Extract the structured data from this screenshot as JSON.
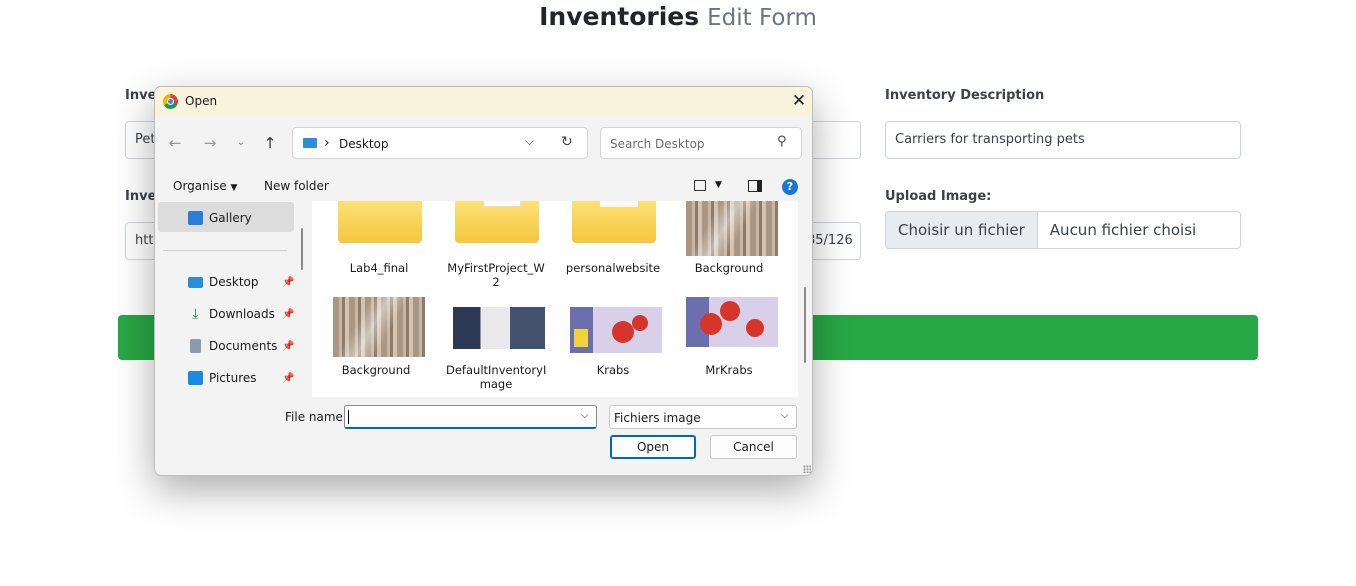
{
  "page": {
    "title": "Inventories",
    "subtitle": "Edit Form",
    "desc_label": "Inventory Description",
    "desc_value": "Carriers for transporting pets",
    "name_label_partial": "Inve",
    "name_value_partial": "Pet",
    "image_label_partial": "Inve",
    "image_value_partial_left": "http",
    "image_value_partial_right": "85/126",
    "upload_label": "Upload Image:",
    "file_button": "Choisir un fichier",
    "file_name": "Aucun fichier choisi",
    "colors": {
      "submit_bar": "#28a745"
    }
  },
  "dialog": {
    "title": "Open",
    "breadcrumb_sep": "›",
    "location": "Desktop",
    "search_placeholder": "Search Desktop",
    "toolbar": {
      "organise": "Organise",
      "new_folder": "New folder",
      "help": "?"
    },
    "nav": [
      {
        "label": "Gallery",
        "icon": "gallery-icon",
        "selected": true
      },
      {
        "label": "Desktop",
        "icon": "desktop-icon",
        "pinned": true
      },
      {
        "label": "Downloads",
        "icon": "downloads-icon",
        "pinned": true
      },
      {
        "label": "Documents",
        "icon": "documents-icon",
        "pinned": true
      },
      {
        "label": "Pictures",
        "icon": "pictures-icon",
        "pinned": true
      }
    ],
    "files": [
      {
        "name": "Lab4_final",
        "kind": "folder"
      },
      {
        "name": "MyFirstProject_W\n2",
        "kind": "folder"
      },
      {
        "name": "personalwebsite",
        "kind": "folder"
      },
      {
        "name": "Background",
        "kind": "image"
      },
      {
        "name": "Background",
        "kind": "image"
      },
      {
        "name": "DefaultInventoryI\nmage",
        "kind": "image"
      },
      {
        "name": "Krabs",
        "kind": "image"
      },
      {
        "name": "MrKrabs",
        "kind": "image"
      }
    ],
    "file_name_label": "File name:",
    "file_name_value": "",
    "file_type": "Fichiers image",
    "open_button": "Open",
    "cancel_button": "Cancel",
    "colors": {
      "title_bar": "#f9f2dd",
      "accent": "#0067c0"
    }
  }
}
